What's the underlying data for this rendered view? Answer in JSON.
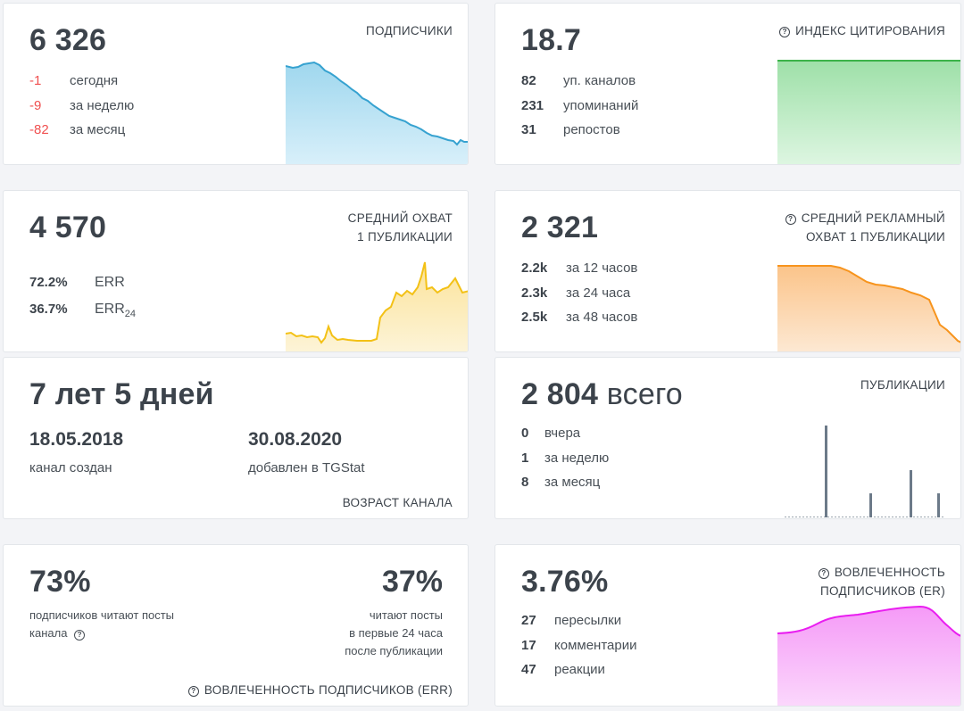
{
  "subscribers": {
    "value": "6 326",
    "title": "ПОДПИСЧИКИ",
    "rows": [
      {
        "value": "-1",
        "label": "сегодня"
      },
      {
        "value": "-9",
        "label": "за неделю"
      },
      {
        "value": "-82",
        "label": "за месяц"
      }
    ],
    "color": "#36a2d0"
  },
  "citation": {
    "value": "18.7",
    "title": "ИНДЕКС ЦИТИРОВАНИЯ",
    "rows": [
      {
        "value": "82",
        "label": "уп. каналов"
      },
      {
        "value": "231",
        "label": "упоминаний"
      },
      {
        "value": "31",
        "label": "репостов"
      }
    ],
    "color": "#3cb34a"
  },
  "avg_reach": {
    "value": "4 570",
    "title_line1": "СРЕДНИЙ ОХВАТ",
    "title_line2": "1 ПУБЛИКАЦИИ",
    "rows": [
      {
        "value": "72.2%",
        "label": "ERR"
      },
      {
        "value": "36.7%",
        "label": "ERR",
        "sub": "24"
      }
    ],
    "color": "#f3c116"
  },
  "ad_reach": {
    "value": "2 321",
    "title_line1": "СРЕДНИЙ РЕКЛАМНЫЙ",
    "title_line2": "ОХВАТ 1 ПУБЛИКАЦИИ",
    "rows": [
      {
        "value": "2.2k",
        "label": "за 12 часов"
      },
      {
        "value": "2.3k",
        "label": "за 24 часа"
      },
      {
        "value": "2.5k",
        "label": "за 48 часов"
      }
    ],
    "color": "#f7941d"
  },
  "age": {
    "value": "7 лет 5 дней",
    "created_date": "18.05.2018",
    "created_label": "канал создан",
    "added_date": "30.08.2020",
    "added_label": "добавлен в TGStat",
    "title": "ВОЗРАСТ КАНАЛА"
  },
  "posts": {
    "value": "2 804",
    "value_suffix": "всего",
    "title": "ПУБЛИКАЦИИ",
    "rows": [
      {
        "value": "0",
        "label": "вчера"
      },
      {
        "value": "1",
        "label": "за неделю"
      },
      {
        "value": "8",
        "label": "за месяц"
      }
    ],
    "color": "#6c7a89"
  },
  "err": {
    "left_value": "73%",
    "left_desc_1": "подписчиков читают посты",
    "left_desc_2": "канала",
    "right_value": "37%",
    "right_desc_1": "читают посты",
    "right_desc_2": "в первые 24 часа",
    "right_desc_3": "после публикации",
    "title": "ВОВЛЕЧЕННОСТЬ ПОДПИСЧИКОВ (ERR)"
  },
  "er": {
    "value": "3.76%",
    "title_line1": "ВОВЛЕЧЕННОСТЬ",
    "title_line2": "ПОДПИСЧИКОВ (ER)",
    "rows": [
      {
        "value": "27",
        "label": "пересылки"
      },
      {
        "value": "17",
        "label": "комментарии"
      },
      {
        "value": "47",
        "label": "реакции"
      }
    ],
    "color": "#e91ef0"
  },
  "icons": {
    "help": "question-circle-icon"
  }
}
